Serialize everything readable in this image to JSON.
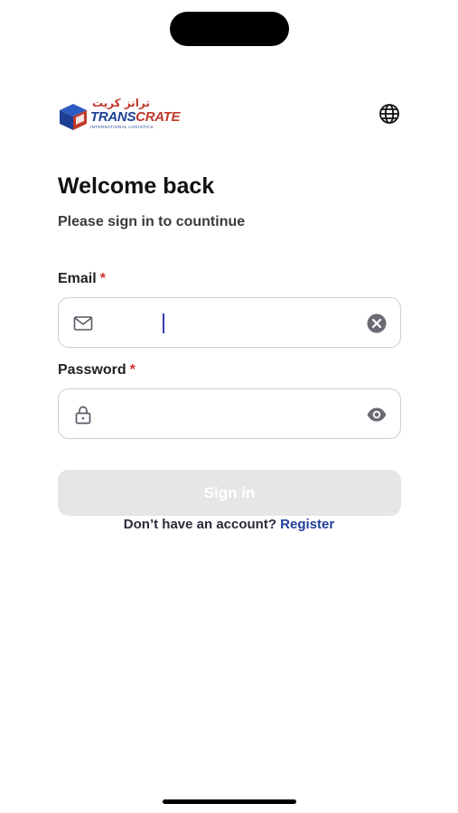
{
  "brand": {
    "name_en_part1": "TRANS",
    "name_en_part2": "CRATE",
    "name_ar": "ترانز كريت",
    "tagline": "INTERNATIONAL LOGISTICS",
    "colors": {
      "blue": "#1c3f94",
      "red": "#c0392b"
    }
  },
  "header": {
    "language_icon": "globe-icon"
  },
  "login": {
    "title": "Welcome back",
    "subtitle": "Please sign in to countinue",
    "email": {
      "label": "Email",
      "required_mark": "*",
      "value": "",
      "leading_icon": "mail-icon",
      "trailing_icon": "clear-icon"
    },
    "password": {
      "label": "Password",
      "required_mark": "*",
      "value": "",
      "leading_icon": "lock-icon",
      "trailing_icon": "eye-icon"
    },
    "submit_label": "Sign in",
    "submit_enabled": false,
    "no_account_text": "Don’t have an account?",
    "register_link": "Register"
  },
  "colors": {
    "link": "#1f3f9a",
    "required": "#d32f2f",
    "disabled_button": "#e6e6e6"
  }
}
